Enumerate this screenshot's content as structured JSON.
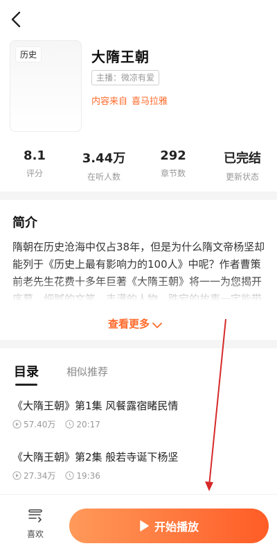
{
  "book": {
    "cover_tag": "历史",
    "title": "大隋王朝",
    "host": "主播：微凉有爱",
    "source_prefix": "内容来自",
    "source_name": "喜马拉雅"
  },
  "stats": [
    {
      "value": "8.1",
      "label": "评分"
    },
    {
      "value": "3.44万",
      "label": "在听人数"
    },
    {
      "value": "292",
      "label": "章节数"
    },
    {
      "value": "已完结",
      "label": "更新状态"
    }
  ],
  "intro": {
    "heading": "简介",
    "text": "隋朝在历史沧海中仅占38年，但是为什么隋文帝杨坚却能列于《历史上最有影响力的100人》中呢？作者曹策前老先生花费十多年巨著《大隋王朝》将一一为您揭开序幕。细腻的文笔，丰满的人物，跌宕的故事一定能带你走进一个隋朝那个时代",
    "more_label": "查看更多"
  },
  "tabs": {
    "catalog": "目录",
    "similar": "相似推荐"
  },
  "episodes": [
    {
      "title": "《大隋王朝》第1集  风餐露宿睹民情",
      "plays": "57.40万",
      "duration": "20:17"
    },
    {
      "title": "《大隋王朝》第2集  般若寺诞下杨坚",
      "plays": "27.34万",
      "duration": "19:36"
    }
  ],
  "bottom": {
    "like_label": "喜欢",
    "play_label": "开始播放"
  },
  "colors": {
    "accent": "#ff6a2a",
    "annotation": "#d62828"
  }
}
